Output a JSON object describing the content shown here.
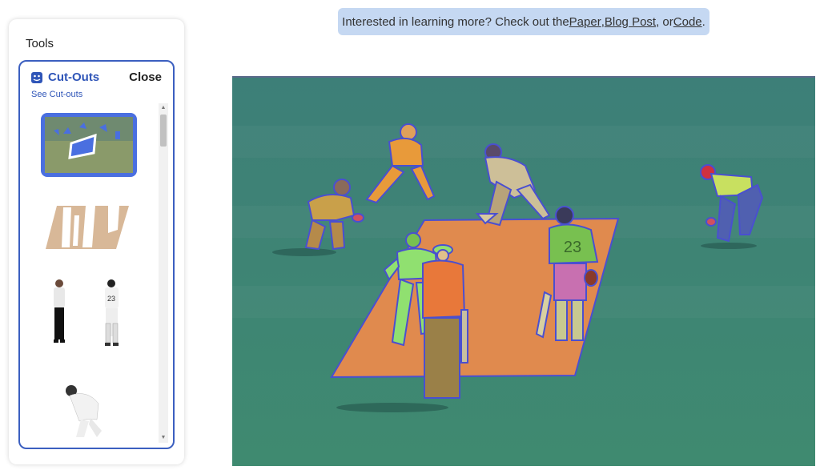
{
  "tools": {
    "title": "Tools",
    "cutouts": {
      "icon": "cutout-icon",
      "title": "Cut-Outs",
      "close_label": "Close",
      "see_link": "See Cut-outs"
    }
  },
  "banner": {
    "prefix": "Interested in learning more? Check out the ",
    "paper": "Paper",
    "sep1": ", ",
    "blog": "Blog Post",
    "sep2": ", or ",
    "code": "Code",
    "suffix": "."
  },
  "main_image": {
    "player_number": "23"
  },
  "thumbs": {
    "number": "23"
  },
  "colors": {
    "accent": "#2f55b8",
    "banner_bg": "#c5d8f2",
    "field": "#3f8a78",
    "pitch": "#e08a4e",
    "outline": "#4a4fd0"
  }
}
